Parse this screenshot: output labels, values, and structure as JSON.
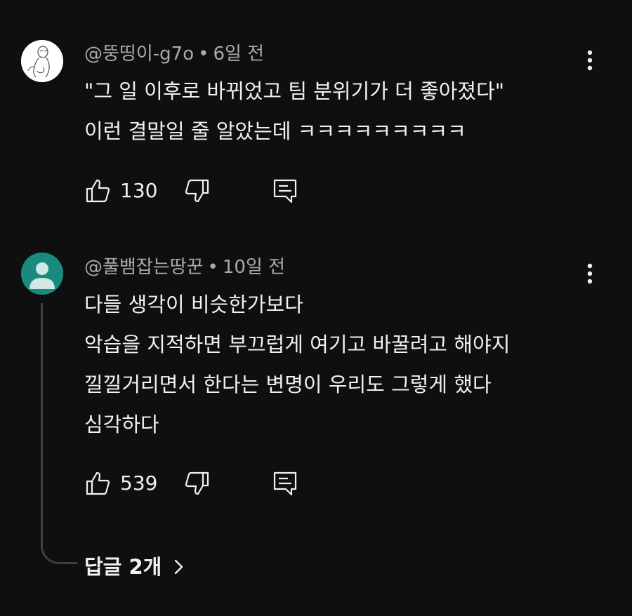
{
  "comments": [
    {
      "author": "@뚱띵이-g7o",
      "time": "6일 전",
      "avatar": "sketch-avatar-icon",
      "lines": [
        "\"그 일 이후로 바뀌었고 팀 분위기가 더 좋아졌다\"",
        "이런 결말일 줄 알았는데 ㅋㅋㅋㅋㅋㅋㅋㅋㅋ"
      ],
      "likes": "130"
    },
    {
      "author": "@풀뱀잡는땅꾼",
      "time": "10일 전",
      "avatar": "default-user-icon",
      "lines": [
        "다들 생각이 비슷한가보다",
        "악습을 지적하면 부끄럽게 여기고 바꿀려고 해야지",
        "낄낄거리면서 한다는 변명이 우리도 그렇게 했다",
        "심각하다"
      ],
      "likes": "539"
    }
  ],
  "separator": "•",
  "replies": {
    "label": "답글 2개"
  },
  "colors": {
    "background": "#0f0f0f",
    "text": "#f1f1f1",
    "meta": "#aaaaaa",
    "default_avatar": "#1a8a7e",
    "thread_line": "#3f3f3f"
  },
  "icons": {
    "like": "thumb-up-icon",
    "dislike": "thumb-down-icon",
    "reply": "comment-reply-icon",
    "more": "more-vert-icon",
    "expand": "chevron-right-icon"
  }
}
